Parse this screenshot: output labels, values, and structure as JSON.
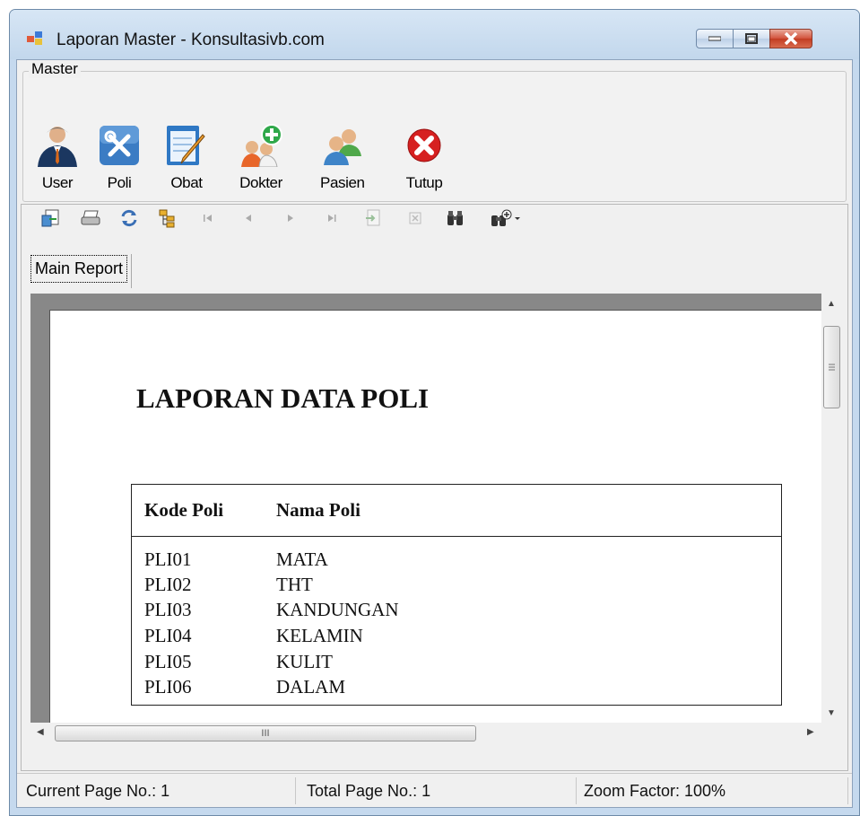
{
  "window": {
    "title": "Laporan Master - Konsultasivb.com"
  },
  "menu": {
    "group_label": "Master",
    "buttons": [
      {
        "label": "User",
        "icon": "user-icon"
      },
      {
        "label": "Poli",
        "icon": "tools-icon"
      },
      {
        "label": "Obat",
        "icon": "notepad-pencil-icon"
      },
      {
        "label": "Dokter",
        "icon": "add-people-icon"
      },
      {
        "label": "Pasien",
        "icon": "people-icon"
      },
      {
        "label": "Tutup",
        "icon": "close-red-icon"
      }
    ]
  },
  "report_toolbar": {
    "tab_label": "Main Report",
    "icons": [
      "export-icon",
      "print-icon",
      "refresh-icon",
      "group-tree-icon",
      "first-page-icon",
      "previous-page-icon",
      "next-page-icon",
      "last-page-icon",
      "go-to-page-icon",
      "stop-icon",
      "search-icon",
      "zoom-icon"
    ]
  },
  "report": {
    "title": "LAPORAN DATA POLI",
    "columns": [
      "Kode Poli",
      "Nama Poli"
    ],
    "rows": [
      [
        "PLI01",
        "MATA"
      ],
      [
        "PLI02",
        "THT"
      ],
      [
        "PLI03",
        "KANDUNGAN"
      ],
      [
        "PLI04",
        "KELAMIN"
      ],
      [
        "PLI05",
        "KULIT"
      ],
      [
        "PLI06",
        "DALAM"
      ]
    ]
  },
  "scrollbar": {
    "grip": "III"
  },
  "status": {
    "current_page": "Current Page No.: 1",
    "total_page": "Total Page No.: 1",
    "zoom": "Zoom Factor: 100%"
  },
  "colors": {
    "title_bar": "#c5d9ee",
    "close_button": "#c94a30",
    "tool_blue": "#2e6fb5",
    "tutup_red": "#d62020"
  }
}
